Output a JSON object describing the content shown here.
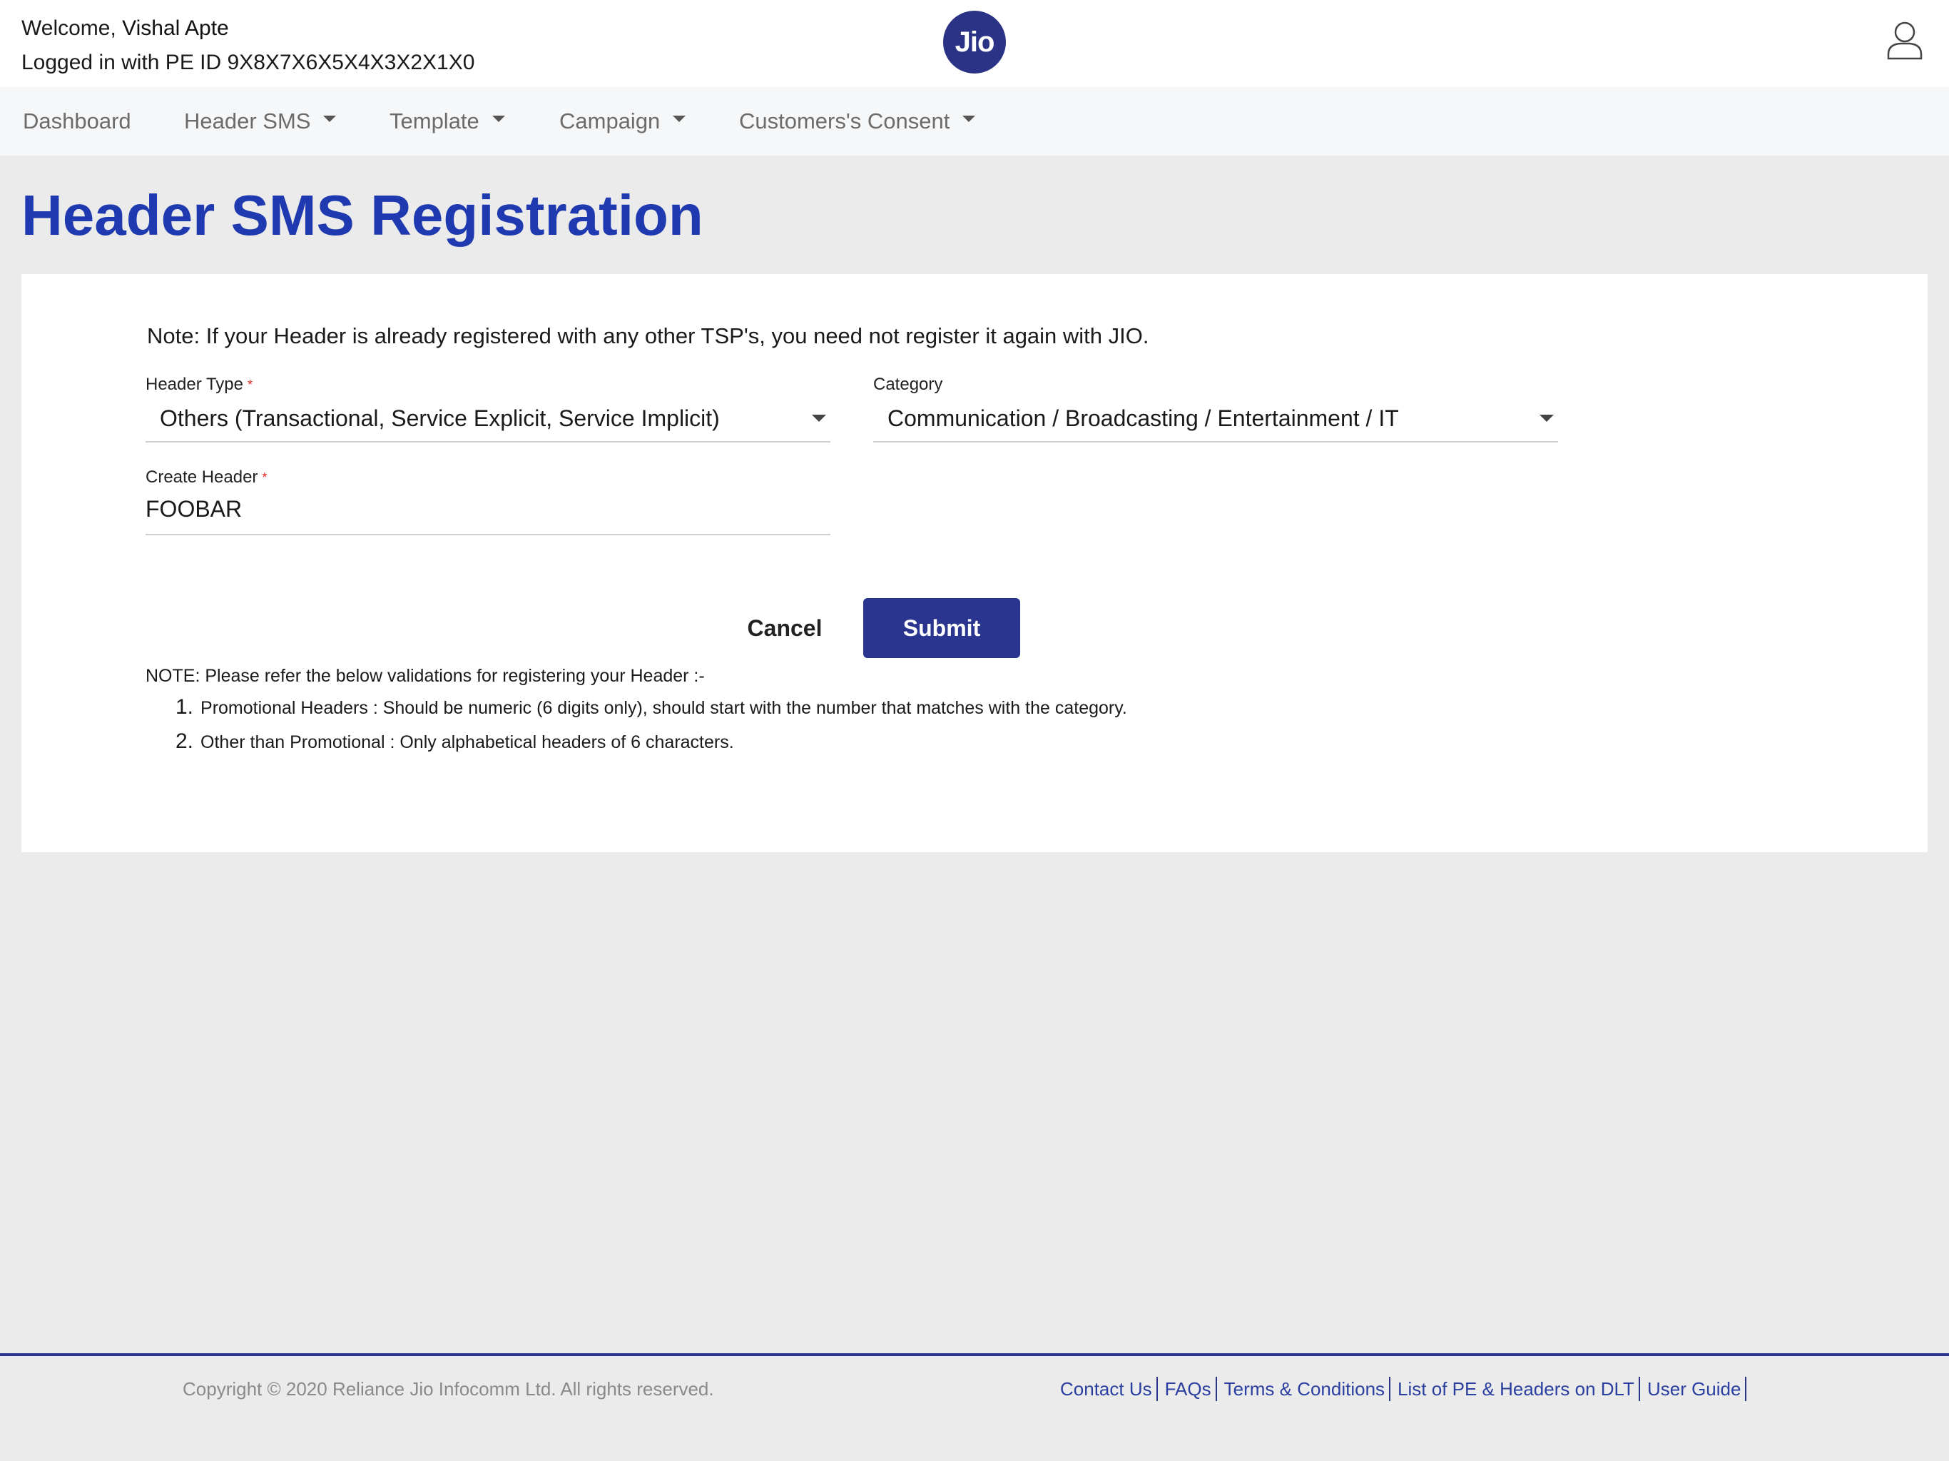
{
  "header": {
    "welcome_prefix": "Welcome,",
    "user_name": "Vishal Apte",
    "login_info": "Logged in with PE ID 9X8X7X6X5X4X3X2X1X0",
    "logo_text": "Jio"
  },
  "nav": {
    "items": [
      {
        "label": "Dashboard",
        "has_dropdown": false
      },
      {
        "label": "Header SMS",
        "has_dropdown": true
      },
      {
        "label": "Template",
        "has_dropdown": true
      },
      {
        "label": "Campaign",
        "has_dropdown": true
      },
      {
        "label": "Customers's Consent",
        "has_dropdown": true
      }
    ]
  },
  "page": {
    "title": "Header SMS Registration"
  },
  "form": {
    "note": "Note: If your Header is already registered with any other TSP's, you need not register it again with JIO.",
    "header_type": {
      "label": "Header Type",
      "required": "*",
      "value": "Others (Transactional, Service Explicit, Service Implicit)"
    },
    "category": {
      "label": "Category",
      "value": "Communication / Broadcasting / Entertainment / IT"
    },
    "create_header": {
      "label": "Create Header",
      "required": "*",
      "value": "FOOBAR"
    },
    "cancel_label": "Cancel",
    "submit_label": "Submit",
    "validations": {
      "title": "NOTE: Please refer the below validations for registering your Header :-",
      "items": [
        {
          "num": "1.",
          "text": "Promotional Headers : Should be numeric (6 digits only), should start with the number that matches with the category."
        },
        {
          "num": "2.",
          "text": "Other than Promotional : Only alphabetical headers of 6 characters."
        }
      ]
    }
  },
  "footer": {
    "copyright": "Copyright © 2020 Reliance Jio Infocomm Ltd. All rights reserved.",
    "links": [
      "Contact Us",
      "FAQs",
      "Terms & Conditions",
      "List of PE & Headers on DLT",
      "User Guide"
    ]
  },
  "colors": {
    "brand_blue": "#2a3590",
    "title_blue": "#1f3ab0",
    "page_bg": "#ebebeb",
    "required_red": "#e0261f"
  },
  "icons": {
    "user": "user-outline-icon",
    "dropdown": "caret-down-icon"
  }
}
